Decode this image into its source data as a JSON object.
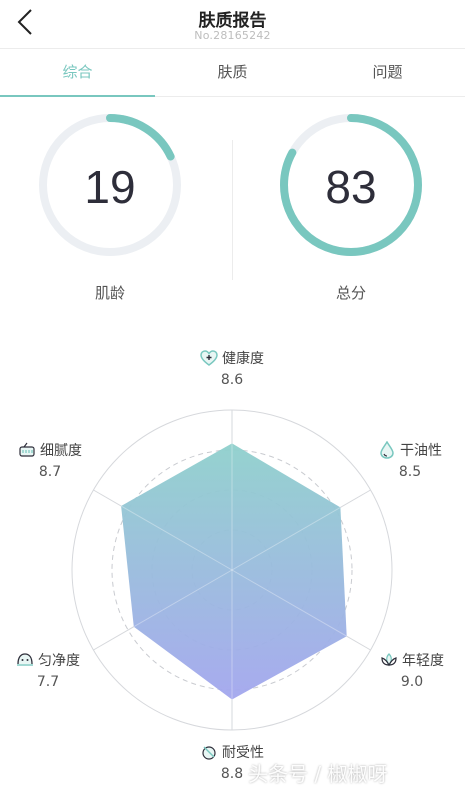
{
  "header": {
    "title": "肤质报告",
    "report_no": "No.28165242"
  },
  "tabs": [
    {
      "label": "综合",
      "active": true
    },
    {
      "label": "肤质",
      "active": false
    },
    {
      "label": "问题",
      "active": false
    }
  ],
  "gauges": [
    {
      "value": "19",
      "label": "肌龄",
      "fraction": 0.18
    },
    {
      "value": "83",
      "label": "总分",
      "fraction": 0.83
    }
  ],
  "colors": {
    "accent": "#79c7bf",
    "track": "#eceff3",
    "radar_top": "#8fd0cc",
    "radar_bottom": "#a3a6ee"
  },
  "chart_data": {
    "type": "radar",
    "axes": [
      {
        "name": "健康度",
        "value": 8.6,
        "value_label": "8.6",
        "icon": "heart-plus-icon"
      },
      {
        "name": "干油性",
        "value": 8.5,
        "value_label": "8.5",
        "icon": "water-drop-icon"
      },
      {
        "name": "年轻度",
        "value": 9.0,
        "value_label": "9.0",
        "icon": "lotus-icon"
      },
      {
        "name": "耐受性",
        "value": 8.8,
        "value_label": "8.8",
        "icon": "shield-icon"
      },
      {
        "name": "匀净度",
        "value": 7.7,
        "value_label": "7.7",
        "icon": "face-icon"
      },
      {
        "name": "细腻度",
        "value": 8.7,
        "value_label": "8.7",
        "icon": "texture-icon"
      }
    ],
    "range": [
      0,
      10
    ]
  },
  "watermark": "头条号 / 椒椒呀"
}
